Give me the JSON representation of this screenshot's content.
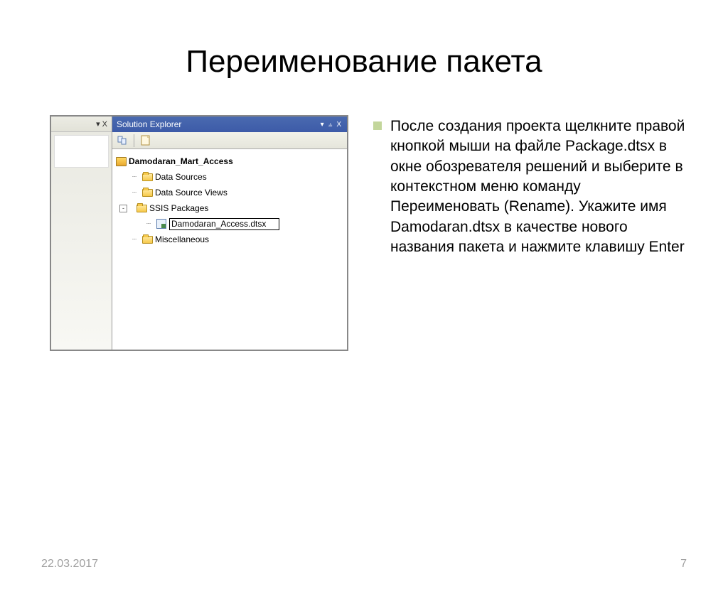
{
  "title": "Переименование пакета",
  "left_strip": {
    "dropdown_glyph": "▾",
    "close_glyph": "X"
  },
  "explorer": {
    "header": "Solution Explorer",
    "pin_glyph": "▾",
    "pushpin_glyph": "⫨",
    "close_glyph": "X",
    "tree": {
      "project": "Damodaran_Mart_Access",
      "data_sources": "Data Sources",
      "data_source_views": "Data Source Views",
      "ssis_packages": "SSIS Packages",
      "rename_value": "Damodaran_Access.dtsx",
      "miscellaneous": "Miscellaneous",
      "collapse": "-"
    }
  },
  "bullet": "После создания проекта щелкните правой кнопкой мыши на файле Package.dtsx в окне обозревателя решений и выберите в контекстном меню команду Переименовать (Rename). Укажите имя Damodaran.dtsx в качестве нового названия пакета и нажмите клавишу Enter",
  "footer": {
    "date": "22.03.2017",
    "page": "7"
  }
}
